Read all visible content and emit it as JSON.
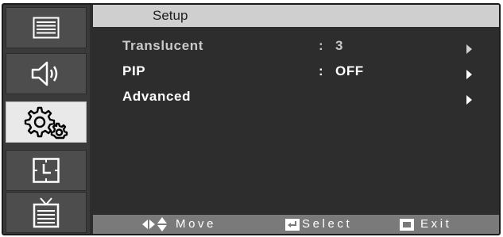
{
  "sidebar": {
    "items": [
      {
        "icon": "picture-menu-icon",
        "active": false
      },
      {
        "icon": "speaker-icon",
        "active": false
      },
      {
        "icon": "gears-icon",
        "active": true
      },
      {
        "icon": "clock-icon",
        "active": false
      },
      {
        "icon": "tv-icon",
        "active": false
      }
    ]
  },
  "header": {
    "title": "Setup"
  },
  "menu": {
    "rows": [
      {
        "label": "Translucent",
        "separator": ":",
        "value": "3"
      },
      {
        "label": "PIP",
        "separator": ":",
        "value": "OFF"
      },
      {
        "label": "Advanced",
        "separator": "",
        "value": ""
      }
    ]
  },
  "footer": {
    "move_label": "Move",
    "select_label": "Select",
    "exit_label": "Exit"
  },
  "colors": {
    "panel": "#2d2d2d",
    "header": "#cfcfcf",
    "footer": "#7a7a7a",
    "active_tab": "#e9e9e9",
    "text": "#ffffff"
  }
}
